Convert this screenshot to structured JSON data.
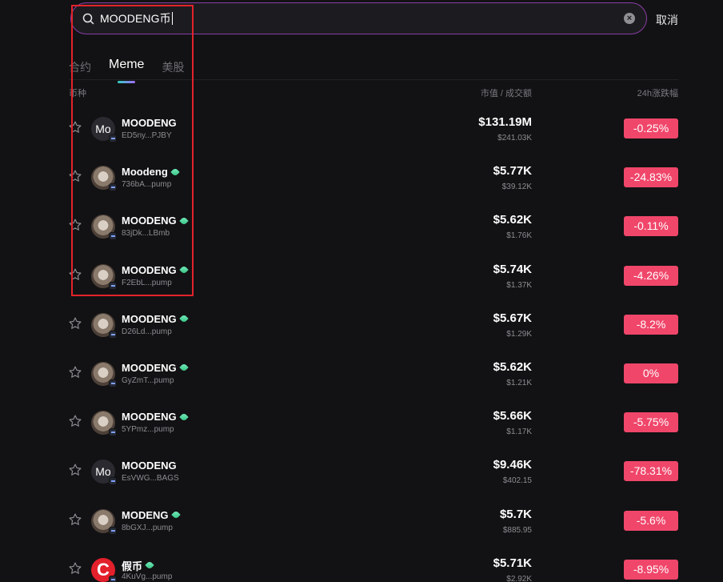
{
  "search": {
    "value": "MOODENG币",
    "cancel_label": "取消"
  },
  "tabs": [
    {
      "label": "合约",
      "active": false
    },
    {
      "label": "Meme",
      "active": true
    },
    {
      "label": "美股",
      "active": false
    }
  ],
  "columns": {
    "coin": "币种",
    "market_cap": "市值 / 成交额",
    "change": "24h涨跌幅"
  },
  "rows": [
    {
      "avatar": "letters",
      "avatar_text": "Mo",
      "name": "MOODENG",
      "verified": false,
      "address": "ED5ny...PJBY",
      "market_cap": "$131.19M",
      "volume": "$241.03K",
      "change": "-0.25%"
    },
    {
      "avatar": "photo",
      "avatar_text": "",
      "name": "Moodeng",
      "verified": true,
      "address": "736bA...pump",
      "market_cap": "$5.77K",
      "volume": "$39.12K",
      "change": "-24.83%"
    },
    {
      "avatar": "photo",
      "avatar_text": "",
      "name": "MOODENG",
      "verified": true,
      "address": "83jDk...LBmb",
      "market_cap": "$5.62K",
      "volume": "$1.76K",
      "change": "-0.11%"
    },
    {
      "avatar": "photo",
      "avatar_text": "",
      "name": "MOODENG",
      "verified": true,
      "address": "F2EbL...pump",
      "market_cap": "$5.74K",
      "volume": "$1.37K",
      "change": "-4.26%"
    },
    {
      "avatar": "photo",
      "avatar_text": "",
      "name": "MOODENG",
      "verified": true,
      "address": "D26Ld...pump",
      "market_cap": "$5.67K",
      "volume": "$1.29K",
      "change": "-8.2%"
    },
    {
      "avatar": "photo",
      "avatar_text": "",
      "name": "MOODENG",
      "verified": true,
      "address": "GyZmT...pump",
      "market_cap": "$5.62K",
      "volume": "$1.21K",
      "change": "0%"
    },
    {
      "avatar": "photo",
      "avatar_text": "",
      "name": "MOODENG",
      "verified": true,
      "address": "5YPmz...pump",
      "market_cap": "$5.66K",
      "volume": "$1.17K",
      "change": "-5.75%"
    },
    {
      "avatar": "letters",
      "avatar_text": "Mo",
      "name": "MOODENG",
      "verified": false,
      "address": "EsVWG...BAGS",
      "market_cap": "$9.46K",
      "volume": "$402.15",
      "change": "-78.31%"
    },
    {
      "avatar": "photo",
      "avatar_text": "",
      "name": "MODENG",
      "verified": true,
      "address": "8bGXJ...pump",
      "market_cap": "$5.7K",
      "volume": "$885.95",
      "change": "-5.6%"
    },
    {
      "avatar": "red",
      "avatar_text": "C",
      "name": "假币",
      "verified": true,
      "address": "4KuVg...pump",
      "market_cap": "$5.71K",
      "volume": "$2.92K",
      "change": "-8.95%"
    }
  ],
  "colors": {
    "accent_border": "#8a3ca6",
    "negative": "#f0466a",
    "background": "#121214",
    "annotation": "#e2232a"
  },
  "icons": [
    "search-icon",
    "clear-icon",
    "star-icon",
    "chain-badge-icon",
    "verified-icon"
  ]
}
